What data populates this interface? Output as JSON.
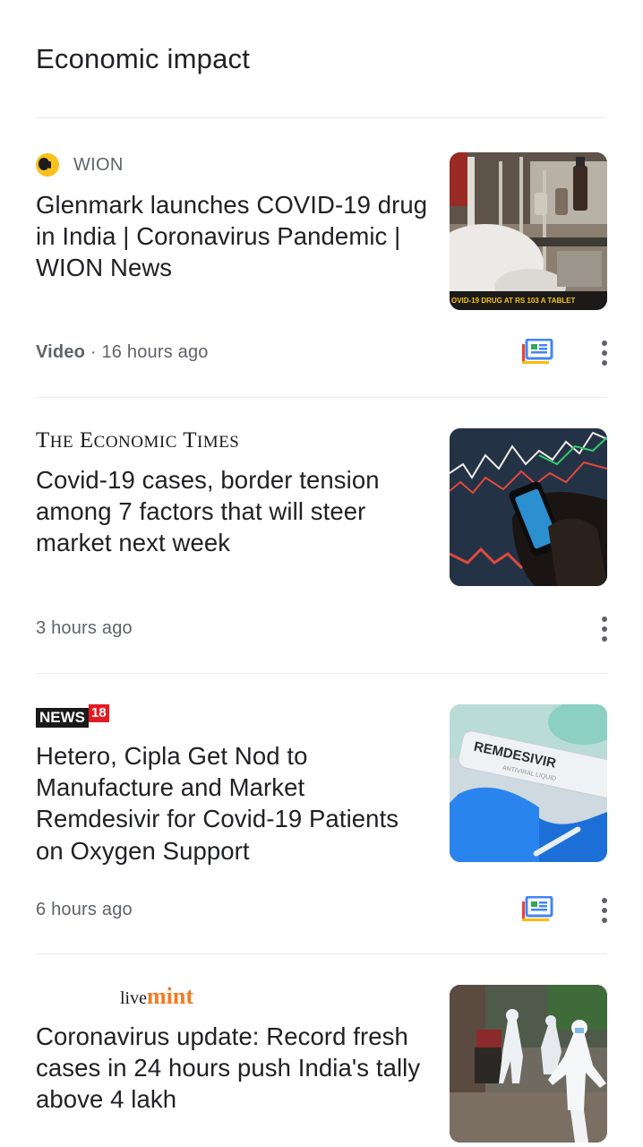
{
  "section": {
    "title": "Economic impact"
  },
  "articles": [
    {
      "source": "WION",
      "headline": "Glenmark launches COVID-19 drug in India | Coronavirus Pandemic | WION News",
      "type": "Video",
      "time": "· 16 hours ago",
      "thumb_caption": "OVID-19 DRUG AT RS 103 A TABLET",
      "has_full_coverage": true
    },
    {
      "source": "THE ECONOMIC TIMES",
      "headline": "Covid-19 cases, border tension among 7 factors that will steer market next week",
      "time": "3 hours ago",
      "has_full_coverage": false
    },
    {
      "source_news": "NEWS",
      "source_num": "18",
      "headline": "Hetero, Cipla Get Nod to Manufacture and Market Remdesivir for Covid-19 Patients on Oxygen Support",
      "time": "6 hours ago",
      "thumb_label": "REMDESIVIR",
      "thumb_sublabel": "ANTIVIRAL LIQUID",
      "has_full_coverage": true
    },
    {
      "source_live": "live",
      "source_mint": "mint",
      "headline": "Coronavirus update: Record fresh cases in 24 hours push India's tally above 4 lakh"
    }
  ],
  "icons": {
    "full_coverage": "full-coverage-icon",
    "more": "more-vert-icon"
  },
  "colors": {
    "text": "#202124",
    "secondary": "#5f6368",
    "divider": "#e8eaed"
  }
}
